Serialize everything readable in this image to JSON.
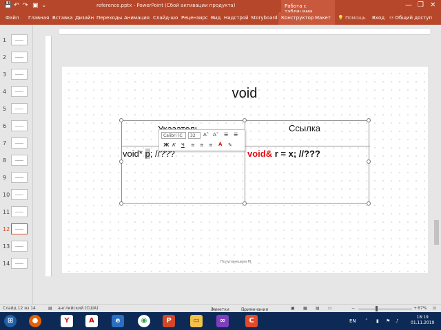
{
  "window": {
    "file_name": "reference.pptx - PowerPoint (Сбой активации продукта)",
    "contextual_header": "Работа с таблицами",
    "minimize_glyph": "—",
    "restore_glyph": "❐",
    "close_glyph": "✕"
  },
  "ribbon": {
    "tabs": [
      "Файл",
      "Главная",
      "Вставка",
      "Дизайн",
      "Переходы",
      "Анимация",
      "Слайд-шо",
      "Рецензирс",
      "Вид",
      "Надстрой",
      "Storyboard",
      "Конструктор",
      "Макет"
    ],
    "tell_me": "Помощь",
    "sign_in": "Вход",
    "share": "Общий доступ"
  },
  "thumbnails": {
    "numbers": [
      "1",
      "2",
      "3",
      "4",
      "5",
      "6",
      "7",
      "8",
      "9",
      "10",
      "11",
      "12",
      "13",
      "14"
    ],
    "active": "12"
  },
  "slide": {
    "title": "void",
    "footer": "Полупанецева М.",
    "table": {
      "header_left": "Указатель",
      "header_right": "Ссылка",
      "cell_left_before": "void* ",
      "cell_left_sel": "p",
      "cell_left_after": "; //???",
      "cell_right_kw": "void&",
      "cell_right_rest": " r = x; //???"
    }
  },
  "minitoolbar": {
    "font": "Calibri (С",
    "size": "32",
    "grow": "A˄",
    "shrink": "A˅",
    "bold": "Ж",
    "italic": "К",
    "underline": "Ч"
  },
  "status": {
    "slide_of": "Слайд 12 из 14",
    "language": "английский (США)",
    "notes": "Заметки",
    "comments": "Примечания",
    "zoom": "67%"
  },
  "taskbar": {
    "lang": "EN",
    "time": "18:19",
    "date": "01.11.2019"
  }
}
